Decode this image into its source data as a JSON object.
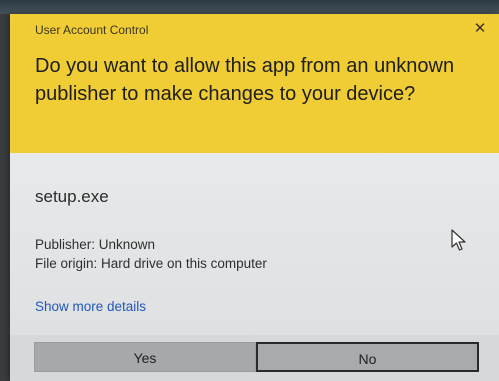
{
  "dialog": {
    "title": "User Account Control",
    "close_glyph": "✕",
    "question": "Do you want to allow this app from an unknown publisher to make changes to your device?",
    "program": "setup.exe",
    "publisher": "Publisher: Unknown",
    "file_origin": "File origin: Hard drive on this computer",
    "details_link": "Show more details",
    "yes_label": "Yes",
    "no_label": "No"
  },
  "icons": {
    "close": "close-icon",
    "cursor": "mouse-pointer-icon"
  },
  "colors": {
    "header_yellow": "#f0cd35",
    "body_gray": "#e3e5e6",
    "link_blue": "#2557b8",
    "button_gray": "#a6a8aa"
  }
}
